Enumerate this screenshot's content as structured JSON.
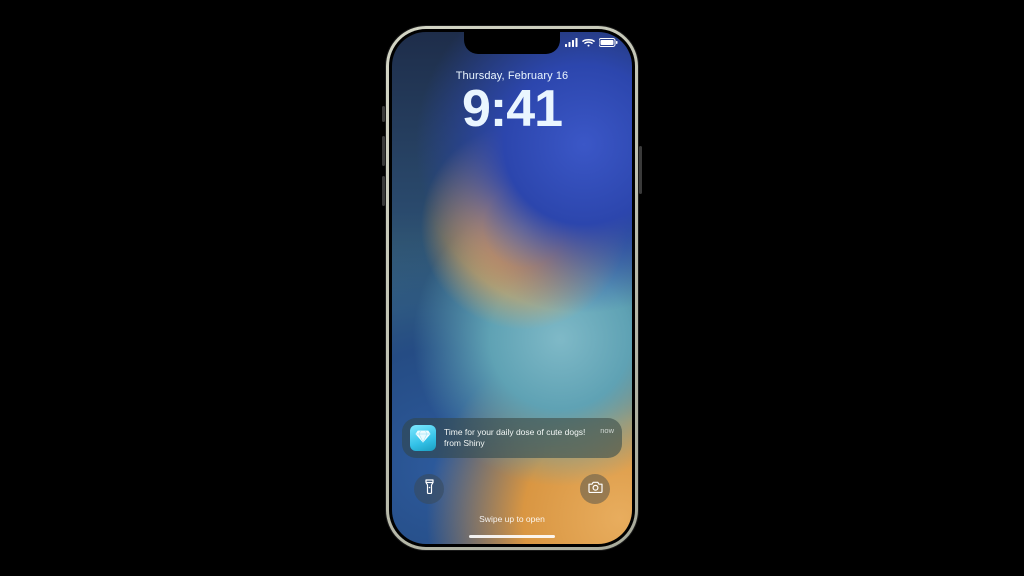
{
  "status": {
    "signal_icon": "signal-icon",
    "wifi_icon": "wifi-icon",
    "battery_icon": "battery-icon"
  },
  "datetime": {
    "date": "Thursday, February 16",
    "time": "9:41"
  },
  "notification": {
    "app_name": "Shiny",
    "title": "Time for your daily dose of cute dogs!",
    "subtitle": "from Shiny",
    "timestamp": "now",
    "icon": "diamond-icon"
  },
  "quick_actions": {
    "flashlight": "flashlight-icon",
    "camera": "camera-icon"
  },
  "hint": "Swipe up to open"
}
